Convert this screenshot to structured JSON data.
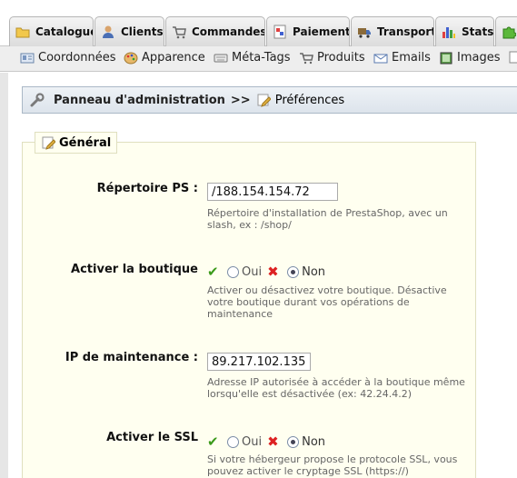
{
  "main_tabs": [
    {
      "label": "Catalogue",
      "icon": "folder-icon"
    },
    {
      "label": "Clients",
      "icon": "user-icon"
    },
    {
      "label": "Commandes",
      "icon": "cart-icon"
    },
    {
      "label": "Paiement",
      "icon": "payment-icon"
    },
    {
      "label": "Transport",
      "icon": "truck-icon"
    },
    {
      "label": "Stats",
      "icon": "bar-chart-icon"
    },
    {
      "label": "",
      "icon": "puzzle-icon"
    }
  ],
  "sub_nav": [
    {
      "label": "Coordonnées",
      "icon": "contact-card-icon"
    },
    {
      "label": "Apparence",
      "icon": "palette-icon"
    },
    {
      "label": "Méta-Tags",
      "icon": "keyboard-icon"
    },
    {
      "label": "Produits",
      "icon": "cart-icon"
    },
    {
      "label": "Emails",
      "icon": "envelope-icon"
    },
    {
      "label": "Images",
      "icon": "image-icon"
    }
  ],
  "breadcrumb": {
    "root": "Panneau d'administration",
    "separator": ">>",
    "current": "Préférences"
  },
  "section": {
    "legend": "Général"
  },
  "fields": {
    "ps_dir": {
      "label": "Répertoire PS :",
      "value": "/188.154.154.72",
      "hint": "Répertoire d'installation de PrestaShop, avec un slash, ex : /shop/"
    },
    "shop_enable": {
      "label": "Activer la boutique",
      "yes": "Oui",
      "no": "Non",
      "selected": "Non",
      "hint": "Activer ou désactivez votre boutique. Désactive votre boutique durant vos opérations de maintenance"
    },
    "maintenance_ip": {
      "label": "IP de maintenance :",
      "value": "89.217.102.135",
      "hint": "Adresse IP autorisée à accéder à la boutique même lorsqu'elle est désactivée (ex: 42.24.4.2)"
    },
    "ssl_enable": {
      "label": "Activer le SSL",
      "yes": "Oui",
      "no": "Non",
      "selected": "Non",
      "hint": "Si votre hébergeur propose le protocole SSL, vous pouvez activer le cryptage SSL (https://)"
    }
  },
  "colors": {
    "fieldset_bg": "#fffff0",
    "breadcrumb_bg": "#e4eaf0",
    "check": "#3a9a1a",
    "cross": "#dd2222"
  }
}
